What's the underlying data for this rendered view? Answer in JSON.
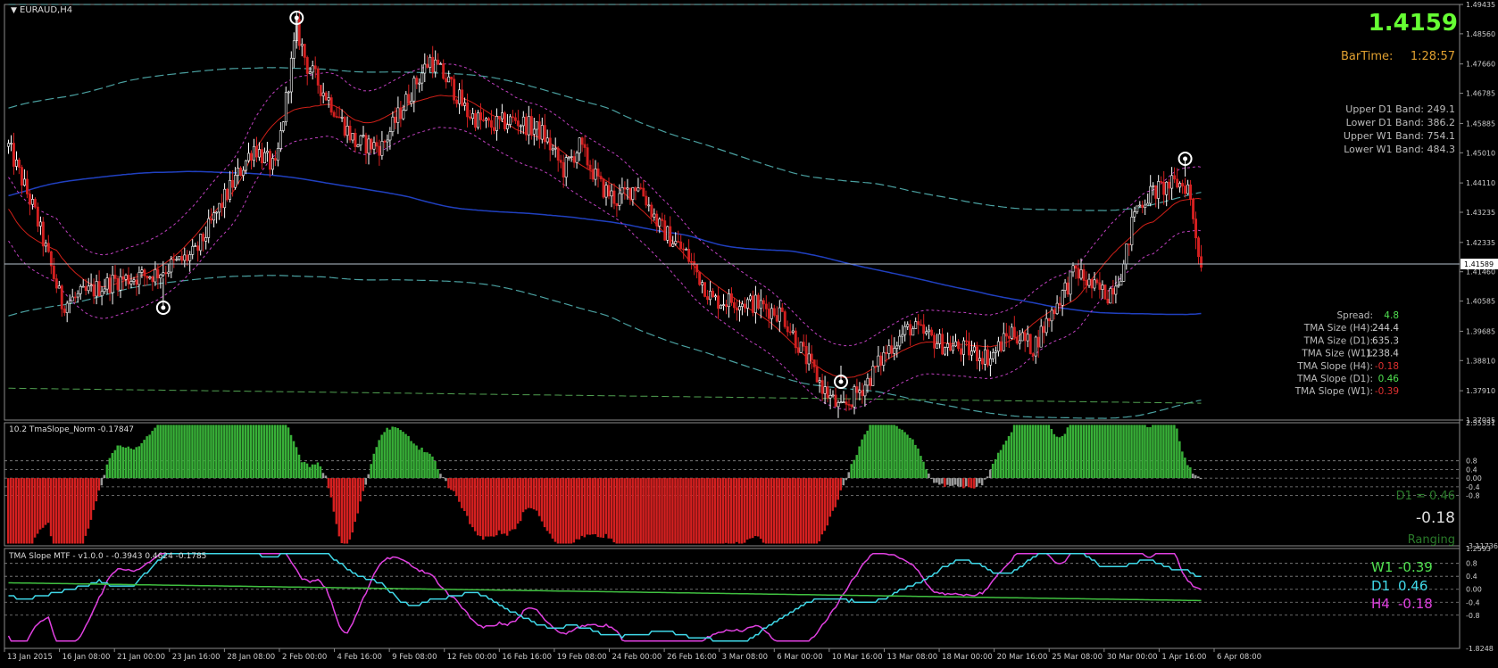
{
  "colors": {
    "background": "#000000",
    "grid": "#c0c0c0",
    "bull": "#3fae3f",
    "bear": "#d42a1e",
    "candle_bull_body": "#ffffff",
    "candle_bear_body": "#d42020",
    "tma_mid_red": "#d02018",
    "tma_band_magenta": "#c040c0",
    "long_blue": "#2040c0",
    "outer_band_cyan": "#4aa0a0",
    "green_text": "#50e050",
    "orange_text": "#e0a030",
    "price_green": "#66ff33",
    "hist_green": "#38b038",
    "hist_red": "#d42020",
    "hist_gray": "#9a9a9a",
    "slope_magenta": "#e040e0",
    "slope_cyan": "#40d8e8",
    "slope_green": "#40c040"
  },
  "main_panel": {
    "title": "EURAUD,H4",
    "price_big": "1.4159",
    "bartime_label": "BarTime:",
    "bartime_value": "1:28:57",
    "current_price_tag": "1.41589",
    "y_labels": [
      "1.49435",
      "1.48560",
      "1.47660",
      "1.46785",
      "1.45885",
      "1.45010",
      "1.44110",
      "1.43235",
      "1.42335",
      "1.41460",
      "1.40585",
      "1.39685",
      "1.38810",
      "1.37910",
      "1.37035"
    ],
    "bands": [
      {
        "label": "Upper D1 Band:",
        "value": "249.1"
      },
      {
        "label": "Lower D1 Band:",
        "value": "386.2"
      },
      {
        "label": "Upper W1 Band:",
        "value": "754.1"
      },
      {
        "label": "Lower W1 Band:",
        "value": "484.3"
      }
    ],
    "stats": [
      {
        "label": "Spread:",
        "value": "4.8",
        "color": "#50e050"
      },
      {
        "label": "TMA Size (H4):",
        "value": "244.4",
        "color": "#cccccc"
      },
      {
        "label": "TMA Size (D1):",
        "value": "635.3",
        "color": "#cccccc"
      },
      {
        "label": "TMA Size (W1):",
        "value": "1238.4",
        "color": "#cccccc"
      },
      {
        "label": "TMA Slope (H4):",
        "value": "-0.18",
        "color": "#e03030"
      },
      {
        "label": "TMA Slope (D1):",
        "value": "0.46",
        "color": "#50e050"
      },
      {
        "label": "TMA Slope (W1):",
        "value": "-0.39",
        "color": "#e03030"
      }
    ]
  },
  "slope_panel": {
    "title": "10.2 TmaSlope_Norm -0.17847",
    "y_labels": [
      "2.55351",
      "0.8",
      "0.4",
      "0.00",
      "-0.4",
      "-0.8",
      "-3.11736"
    ],
    "d1_text": "D1 = 0.46",
    "value_text": "-0.18",
    "state_text": "Ranging"
  },
  "mtf_panel": {
    "title": "TMA Slope MTF - v1.0.0 - -0.3943 0.4624 -0.1785",
    "y_labels": [
      "1.2593",
      "0.8",
      "0.4",
      "0.00",
      "-0.4",
      "-0.8",
      "-1.8248"
    ],
    "w1_label": "W1",
    "w1_value": "-0.39",
    "d1_label": "D1",
    "d1_value": "0.46",
    "h4_label": "H4",
    "h4_value": "-0.18"
  },
  "x_labels": [
    "13 Jan 2015",
    "16 Jan 08:00",
    "21 Jan 00:00",
    "23 Jan 16:00",
    "28 Jan 08:00",
    "2 Feb 00:00",
    "4 Feb 16:00",
    "9 Feb 08:00",
    "12 Feb 00:00",
    "16 Feb 16:00",
    "19 Feb 08:00",
    "24 Feb 00:00",
    "26 Feb 16:00",
    "3 Mar 08:00",
    "6 Mar 00:00",
    "10 Mar 16:00",
    "13 Mar 08:00",
    "18 Mar 00:00",
    "20 Mar 16:00",
    "25 Mar 08:00",
    "30 Mar 00:00",
    "1 Apr 16:00",
    "6 Apr 08:00"
  ],
  "chart_data": {
    "type": "candlestick",
    "symbol": "EURAUD,H4",
    "ylim": [
      1.37035,
      1.49435
    ],
    "close_anchors": [
      [
        0,
        1.452
      ],
      [
        10,
        1.432
      ],
      [
        20,
        1.405
      ],
      [
        40,
        1.412
      ],
      [
        55,
        1.414
      ],
      [
        70,
        1.42
      ],
      [
        82,
        1.438
      ],
      [
        92,
        1.452
      ],
      [
        100,
        1.445
      ],
      [
        108,
        1.487
      ],
      [
        112,
        1.476
      ],
      [
        120,
        1.466
      ],
      [
        130,
        1.453
      ],
      [
        140,
        1.452
      ],
      [
        152,
        1.47
      ],
      [
        158,
        1.478
      ],
      [
        166,
        1.47
      ],
      [
        172,
        1.462
      ],
      [
        180,
        1.458
      ],
      [
        190,
        1.46
      ],
      [
        200,
        1.456
      ],
      [
        208,
        1.445
      ],
      [
        214,
        1.452
      ],
      [
        222,
        1.44
      ],
      [
        228,
        1.436
      ],
      [
        236,
        1.441
      ],
      [
        244,
        1.428
      ],
      [
        254,
        1.42
      ],
      [
        264,
        1.406
      ],
      [
        272,
        1.406
      ],
      [
        280,
        1.405
      ],
      [
        290,
        1.402
      ],
      [
        298,
        1.39
      ],
      [
        306,
        1.379
      ],
      [
        312,
        1.373
      ],
      [
        322,
        1.382
      ],
      [
        330,
        1.392
      ],
      [
        338,
        1.398
      ],
      [
        350,
        1.393
      ],
      [
        360,
        1.391
      ],
      [
        368,
        1.389
      ],
      [
        376,
        1.397
      ],
      [
        384,
        1.392
      ],
      [
        392,
        1.404
      ],
      [
        400,
        1.415
      ],
      [
        406,
        1.41
      ],
      [
        412,
        1.408
      ],
      [
        418,
        1.416
      ],
      [
        422,
        1.433
      ],
      [
        428,
        1.438
      ],
      [
        434,
        1.44
      ],
      [
        438,
        1.441
      ],
      [
        442,
        1.44
      ],
      [
        444,
        1.431
      ],
      [
        447,
        1.416
      ]
    ],
    "n_bars": 448,
    "last_price": 1.41589
  }
}
